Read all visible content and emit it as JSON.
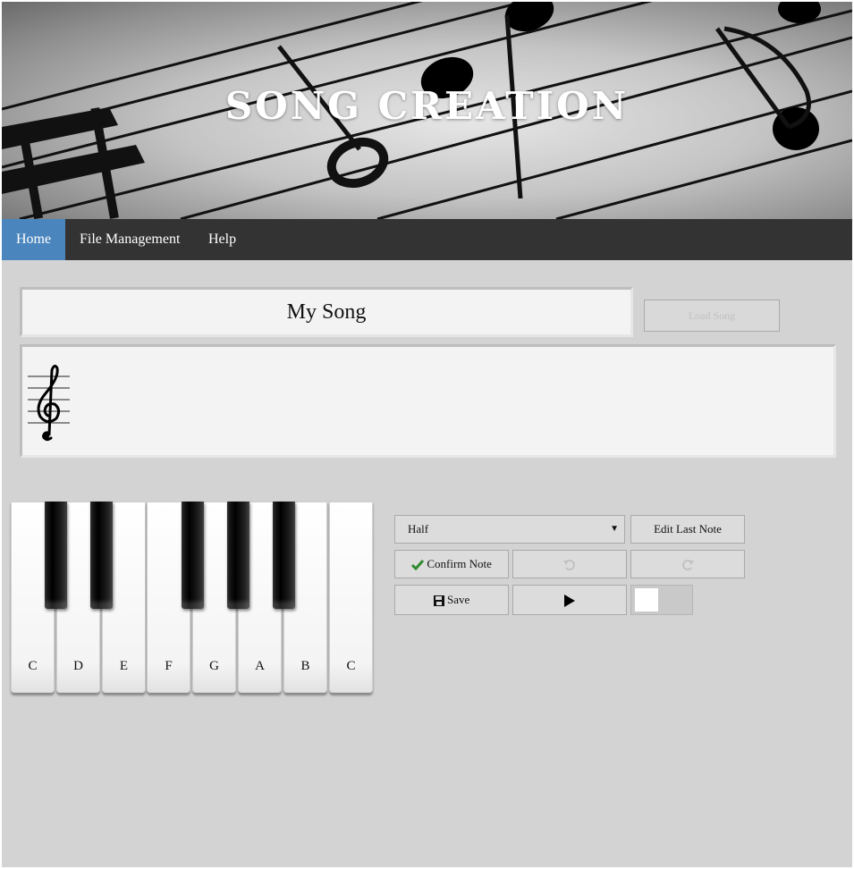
{
  "banner": {
    "title": "SONG CREATION"
  },
  "nav": {
    "items": [
      {
        "label": "Home",
        "active": true
      },
      {
        "label": "File Management",
        "active": false
      },
      {
        "label": "Help",
        "active": false
      }
    ]
  },
  "song": {
    "title": "My Song",
    "load_label": "Load Song"
  },
  "staff": {
    "clef": "treble-clef-icon"
  },
  "piano": {
    "white_keys": [
      "C",
      "D",
      "E",
      "F",
      "G",
      "A",
      "B",
      "C"
    ]
  },
  "controls": {
    "duration": {
      "selected": "Half"
    },
    "edit_last_label": "Edit Last Note",
    "confirm_label": "Confirm Note",
    "save_label": "Save",
    "icons": {
      "confirm": "check-icon",
      "undo": "undo-icon",
      "redo": "redo-icon",
      "save": "floppy-disk-icon",
      "play": "play-icon"
    }
  },
  "colors": {
    "nav_bg": "#333333",
    "nav_active": "#4a86bd",
    "page_bg": "#d3d3d3",
    "check": "#2e8b2e"
  }
}
